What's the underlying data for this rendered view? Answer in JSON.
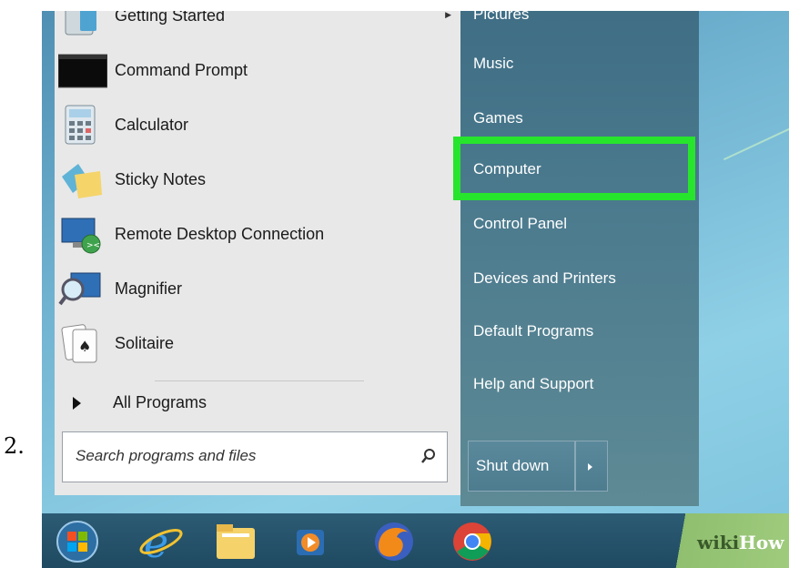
{
  "step_number": "2.",
  "start_menu": {
    "programs": [
      {
        "label": "Getting Started",
        "icon": "getting-started-icon",
        "has_submenu": true
      },
      {
        "label": "Command Prompt",
        "icon": "command-prompt-icon"
      },
      {
        "label": "Calculator",
        "icon": "calculator-icon"
      },
      {
        "label": "Sticky Notes",
        "icon": "sticky-notes-icon"
      },
      {
        "label": "Remote Desktop Connection",
        "icon": "remote-desktop-icon"
      },
      {
        "label": "Magnifier",
        "icon": "magnifier-icon"
      },
      {
        "label": "Solitaire",
        "icon": "solitaire-icon"
      }
    ],
    "all_programs_label": "All Programs",
    "search_placeholder": "Search programs and files",
    "right_items": [
      {
        "label": "Pictures"
      },
      {
        "label": "Music"
      },
      {
        "label": "Games"
      },
      {
        "label": "Computer",
        "highlighted": true
      },
      {
        "label": "Control Panel"
      },
      {
        "label": "Devices and Printers"
      },
      {
        "label": "Default Programs"
      },
      {
        "label": "Help and Support"
      }
    ],
    "shutdown_label": "Shut down",
    "highlight_color": "#27e52c"
  },
  "taskbar": {
    "icons": [
      "start-orb-icon",
      "internet-explorer-icon",
      "file-explorer-icon",
      "media-player-icon",
      "firefox-icon",
      "chrome-icon"
    ]
  },
  "watermark": {
    "wiki": "wiki",
    "how": "How"
  }
}
